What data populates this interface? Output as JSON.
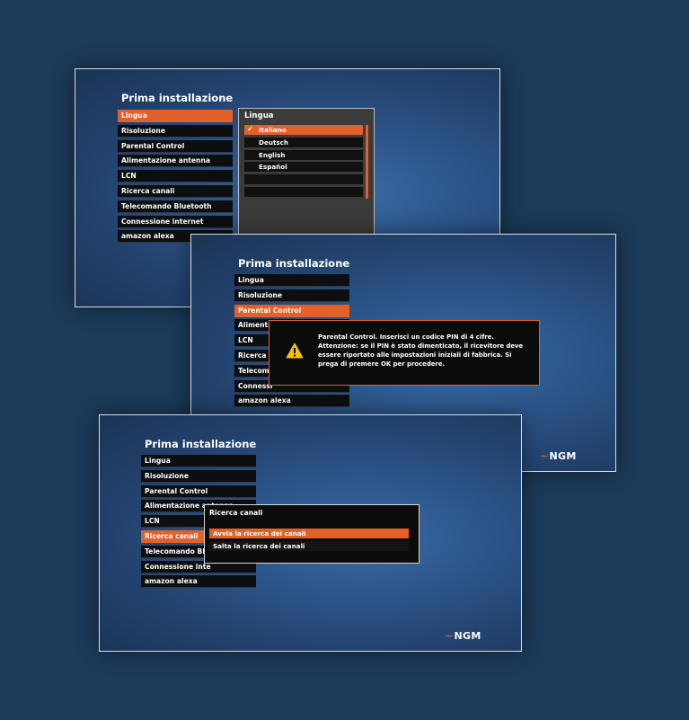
{
  "screen1": {
    "title": "Prima installazione",
    "menu": [
      "Lingua",
      "Risoluzione",
      "Parental Control",
      "Alimentazione antenna",
      "LCN",
      "Ricerca canali",
      "Telecomando Bluetooth",
      "Connessione internet",
      "amazon alexa"
    ],
    "language_panel": {
      "title": "Lingua",
      "options": [
        "Italiano",
        "Deutsch",
        "English",
        "Español"
      ],
      "selected": "Italiano",
      "check_glyph": "✓"
    }
  },
  "screen2": {
    "title": "Prima installazione",
    "menu": [
      "Lingua",
      "Risoluzione",
      "Parental Control",
      "Alimenta",
      "LCN",
      "Ricerca c",
      "Telecoma",
      "Connessi",
      "amazon alexa"
    ],
    "dialog": {
      "lines": [
        "Parental Control. Inserisci un codice PIN di 4 cifre.",
        "Attenzione: se il PIN è stato dimenticato, il ricevitore deve",
        "essere riportato alle impostazioni iniziali di fabbrica. Si",
        "prega di premere OK per procedere."
      ],
      "icon": "warning-icon"
    },
    "logo": "NGM"
  },
  "screen3": {
    "title": "Prima installazione",
    "menu": [
      "Lingua",
      "Risoluzione",
      "Parental Control",
      "Alimentazione antenna",
      "LCN",
      "Ricerca canali",
      "Telecomando Blue",
      "Connessione inte",
      "amazon alexa"
    ],
    "dialog": {
      "title": "Ricerca canali",
      "options": [
        "Avvia la ricerca dei canali",
        "Salta la ricerca dei canali"
      ]
    },
    "logo": "NGM"
  },
  "colors": {
    "accent": "#e2602a",
    "item_bg": "#0d0e10",
    "page_bg": "#1c3a59"
  }
}
